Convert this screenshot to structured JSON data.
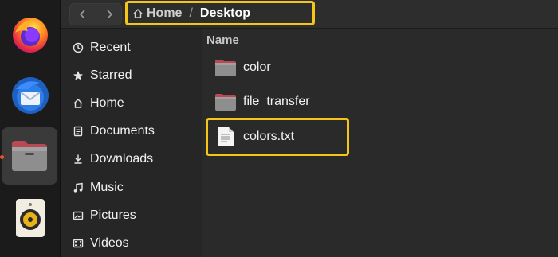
{
  "dock": {
    "items": [
      {
        "name": "firefox-icon"
      },
      {
        "name": "thunderbird-icon"
      },
      {
        "name": "files-icon",
        "active": true
      },
      {
        "name": "rhythmbox-icon"
      }
    ]
  },
  "header": {
    "back_icon": "chevron-left-icon",
    "forward_icon": "chevron-right-icon",
    "breadcrumb": {
      "home_label": "Home",
      "separator": "/",
      "current_label": "Desktop"
    }
  },
  "sidebar": {
    "items": [
      {
        "label": "Recent",
        "icon": "clock-icon"
      },
      {
        "label": "Starred",
        "icon": "star-icon"
      },
      {
        "label": "Home",
        "icon": "home-icon"
      },
      {
        "label": "Documents",
        "icon": "document-icon"
      },
      {
        "label": "Downloads",
        "icon": "download-icon"
      },
      {
        "label": "Music",
        "icon": "music-icon"
      },
      {
        "label": "Pictures",
        "icon": "picture-icon"
      },
      {
        "label": "Videos",
        "icon": "video-icon"
      }
    ]
  },
  "content": {
    "column_header": "Name",
    "files": [
      {
        "name": "color",
        "type": "folder"
      },
      {
        "name": "file_transfer",
        "type": "folder"
      },
      {
        "name": "colors.txt",
        "type": "text-file"
      }
    ]
  },
  "colors": {
    "highlight": "#f5c518",
    "accent": "#e95420",
    "background": "#2a2a2a"
  }
}
